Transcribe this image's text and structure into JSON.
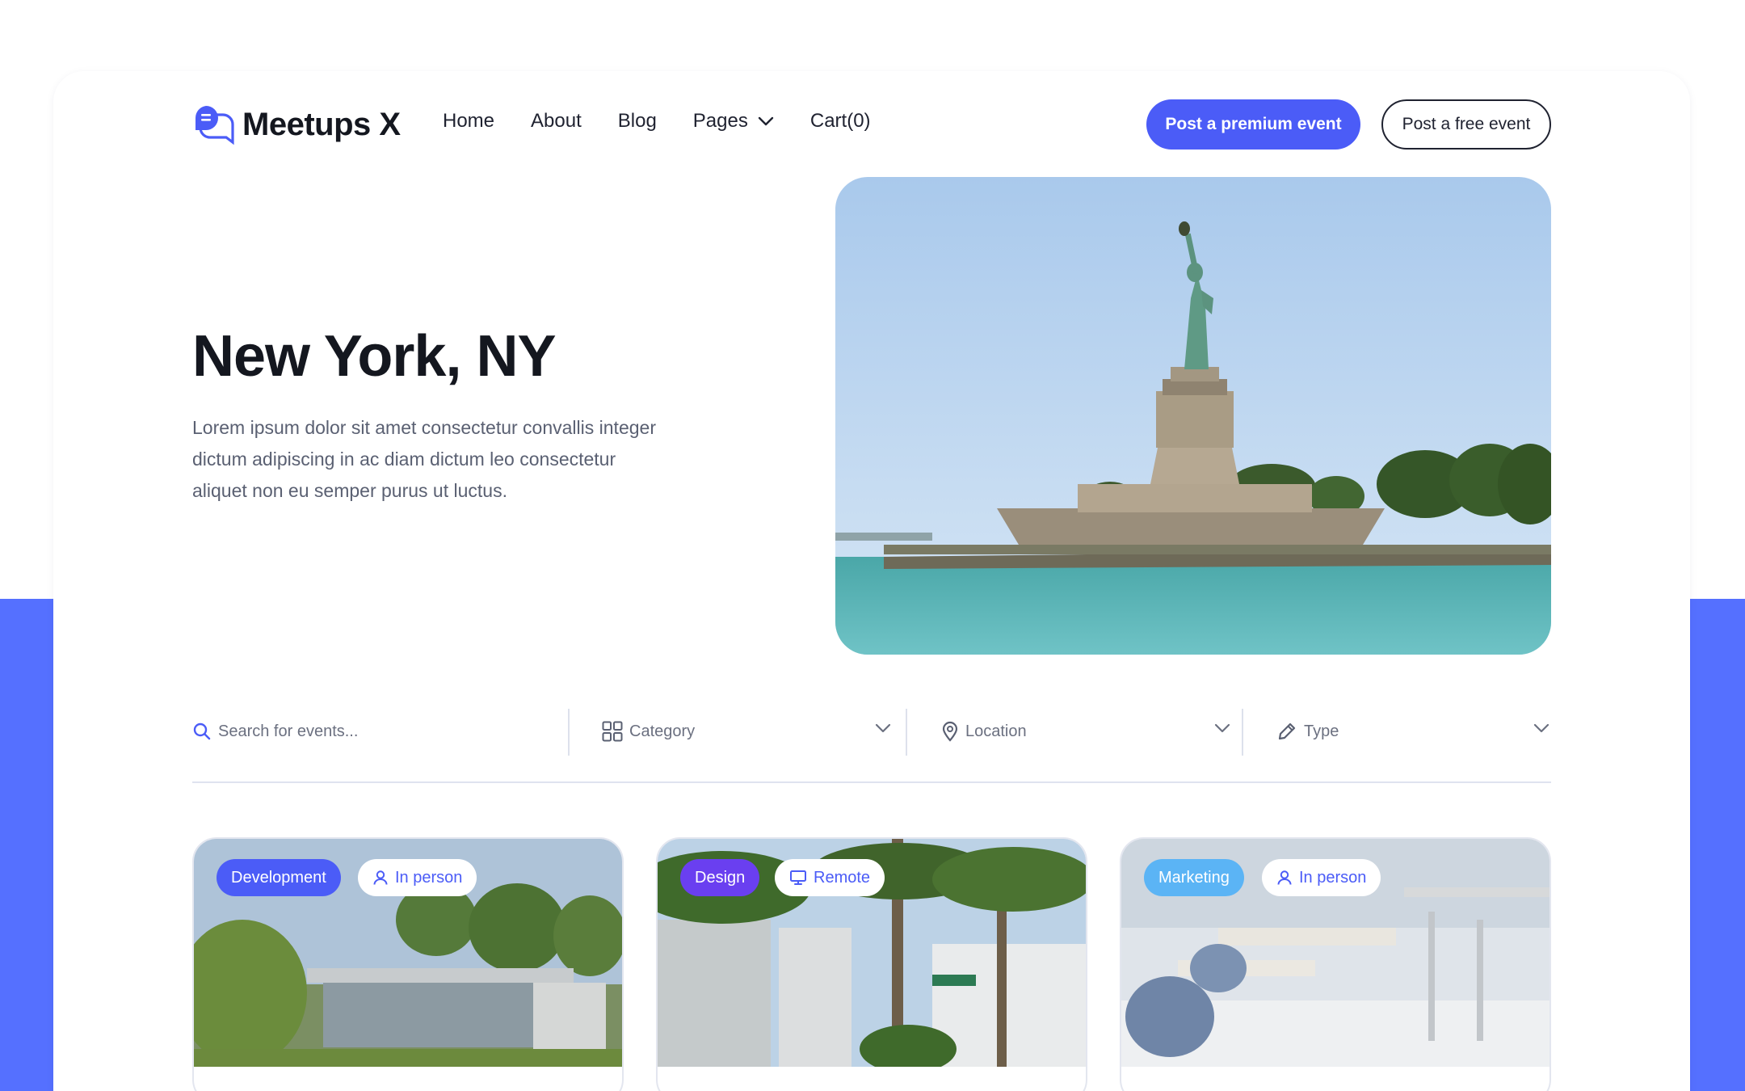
{
  "brand": {
    "name": "Meetups X",
    "accent": "#4b5cf7",
    "section_color": "#5570ff"
  },
  "nav": {
    "items": [
      {
        "label": "Home"
      },
      {
        "label": "About"
      },
      {
        "label": "Blog"
      },
      {
        "label": "Pages",
        "has_dropdown": true
      },
      {
        "label": "Cart(0)"
      }
    ],
    "premium_button": "Post a premium event",
    "free_button": "Post a free event"
  },
  "hero": {
    "title": "New York, NY",
    "description": "Lorem ipsum dolor sit amet consectetur convallis integer dictum adipiscing in ac diam dictum leo consectetur aliquet non eu semper purus ut luctus.",
    "image_icon": "statue-of-liberty-photo"
  },
  "filters": {
    "search_placeholder": "Search for events...",
    "category": "Category",
    "location": "Location",
    "type": "Type"
  },
  "events": [
    {
      "category": "Development",
      "category_color": "#4b5cf7",
      "mode": "In person",
      "mode_icon": "user-icon"
    },
    {
      "category": "Design",
      "category_color": "#6a3ff0",
      "mode": "Remote",
      "mode_icon": "monitor-icon"
    },
    {
      "category": "Marketing",
      "category_color": "#5bb4f5",
      "mode": "In person",
      "mode_icon": "user-icon"
    }
  ]
}
